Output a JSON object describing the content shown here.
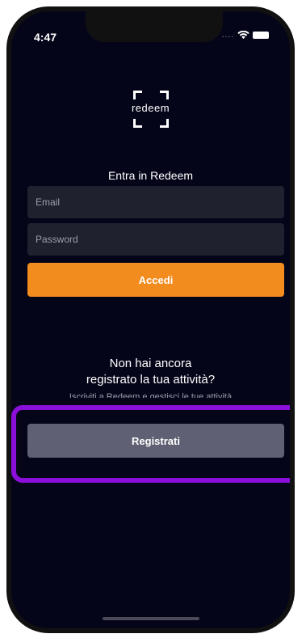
{
  "status_bar": {
    "time": "4:47",
    "signal_dots": "....",
    "wifi_icon": "wifi-icon",
    "battery_icon": "battery-icon"
  },
  "brand": {
    "logo_text": "redeem"
  },
  "login": {
    "title": "Entra in Redeem",
    "email_placeholder": "Email",
    "password_placeholder": "Password",
    "login_button": "Accedi"
  },
  "register": {
    "prompt": "Non hai ancora registrato la tua attività?",
    "subtitle": "Iscriviti a Redeem e gestisci le tue attività",
    "register_button": "Registrati"
  },
  "colors": {
    "background": "#05051a",
    "primary_button": "#f28c1f",
    "secondary_button": "#5f6073",
    "highlight": "#8a0fd9"
  }
}
